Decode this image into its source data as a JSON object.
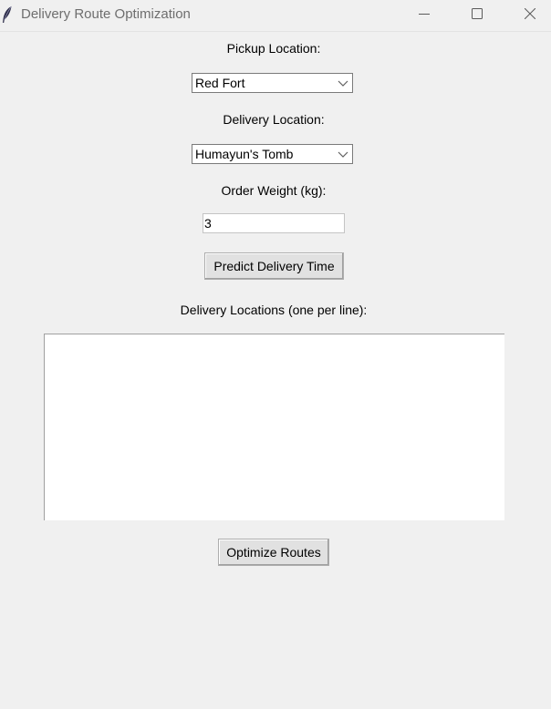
{
  "window": {
    "title": "Delivery Route Optimization",
    "icon": "feather-icon",
    "controls": [
      "minimize-icon",
      "maximize-icon",
      "close-icon"
    ]
  },
  "form": {
    "pickup_label": "Pickup Location:",
    "pickup_value": "Red Fort",
    "delivery_label": "Delivery Location:",
    "delivery_value": "Humayun's Tomb",
    "weight_label": "Order Weight (kg):",
    "weight_value": "3",
    "predict_button": "Predict Delivery Time"
  },
  "routes": {
    "locations_label": "Delivery Locations (one per line):",
    "locations_text": "",
    "optimize_button": "Optimize Routes"
  },
  "colors": {
    "window_bg": "#f0f0f0",
    "button_bg": "#e1e1e1",
    "title_text": "#6e6e6e"
  }
}
